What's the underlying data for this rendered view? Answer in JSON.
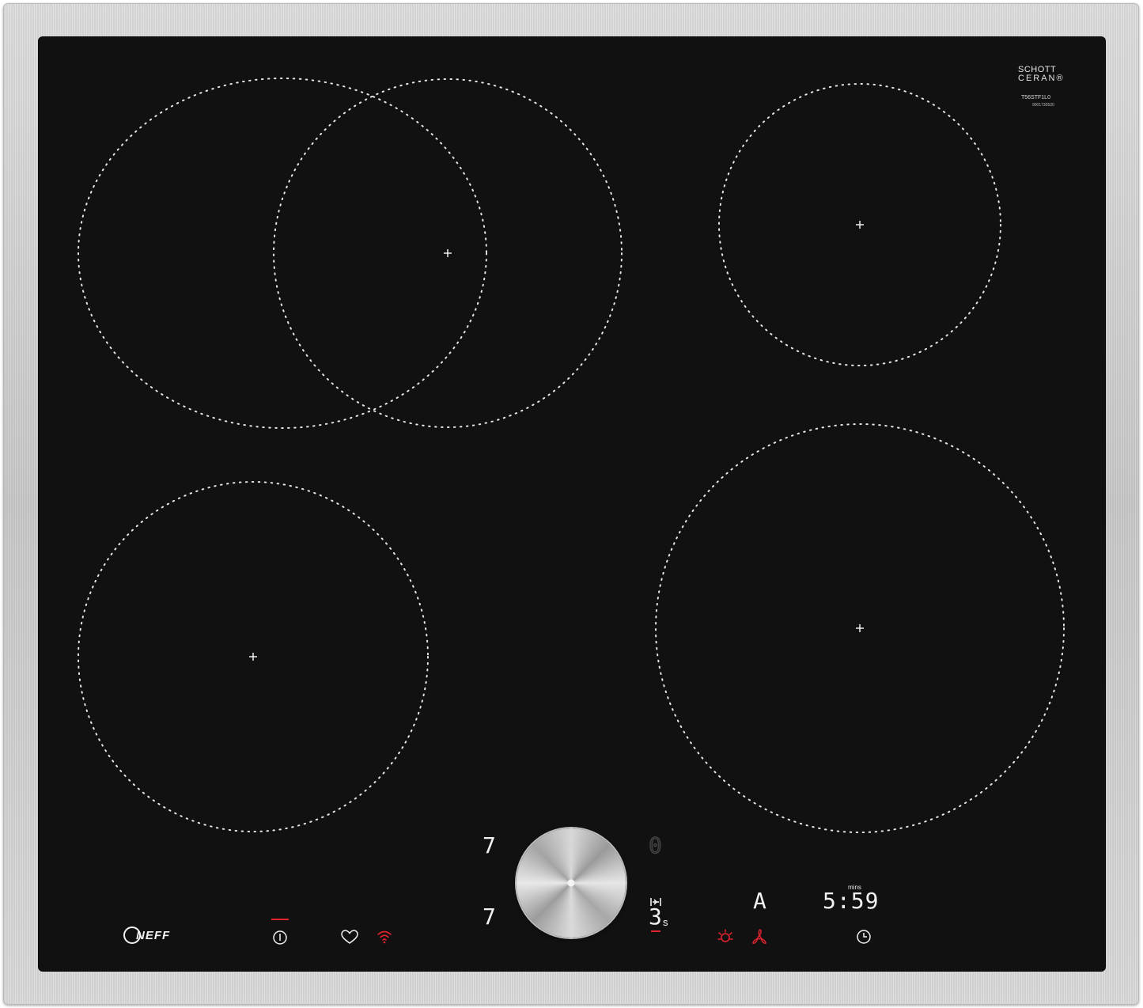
{
  "brand": {
    "logo_text": "NEFF"
  },
  "glass_label": {
    "schott_line1": "SCHOTT",
    "schott_line2": "CERAN®",
    "model": "T56STF1L0",
    "serial": "9001730520"
  },
  "controls": {
    "left_top_level": "7",
    "left_bottom_level": "7",
    "right_top_level": "0",
    "power_boost_level": "3",
    "power_boost_suffix": "s",
    "auto_indicator": "A",
    "timer_value": "5:59",
    "timer_unit": "mins"
  },
  "icons": {
    "power": "power-icon",
    "favourite": "heart-icon",
    "wifi": "wifi-icon",
    "boost": "boost-icon",
    "frying_sensor": "frying-sensor-icon",
    "ventilation": "fan-icon",
    "timer": "clock-icon"
  },
  "colors": {
    "glass": "#111112",
    "frame": "#cfcfcf",
    "active_red": "#e0232e",
    "zone_dots": "#e6e6e6"
  }
}
